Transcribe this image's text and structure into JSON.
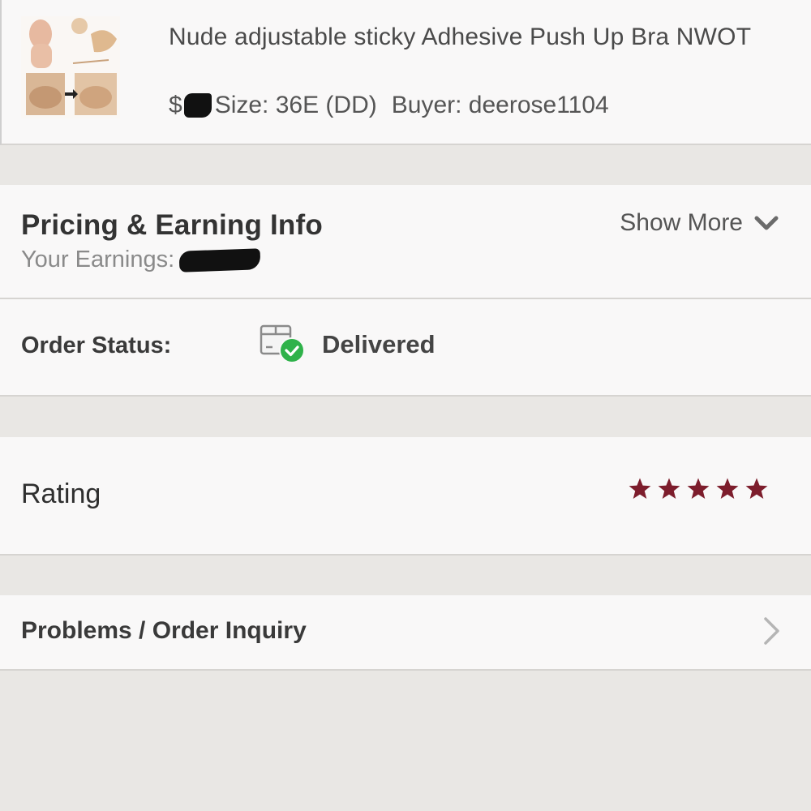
{
  "product": {
    "title": "Nude adjustable sticky Adhesive Push Up Bra NWOT",
    "price_prefix": "$",
    "size": "Size: 36E (DD)",
    "buyer": "Buyer: deerose1104"
  },
  "pricing": {
    "title": "Pricing & Earning Info",
    "earnings_label": "Your Earnings:",
    "show_more_label": "Show More"
  },
  "order_status": {
    "label": "Order Status:",
    "value": "Delivered",
    "icon": "package-delivered-icon"
  },
  "rating": {
    "label": "Rating",
    "stars": 5,
    "max_stars": 5,
    "star_color": "#7d1d2c"
  },
  "problems": {
    "label": "Problems / Order Inquiry"
  },
  "colors": {
    "background": "#e9e7e4",
    "card": "#f9f8f8",
    "check_green": "#2fb24a",
    "star": "#7d1d2c"
  }
}
